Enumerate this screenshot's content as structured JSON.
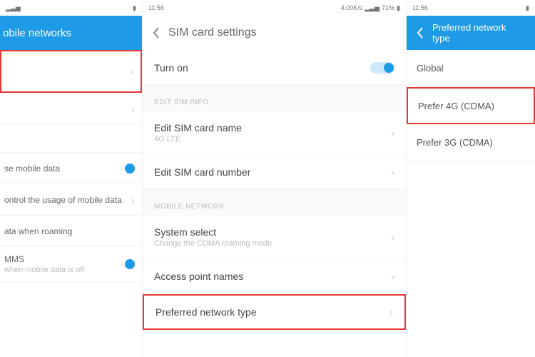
{
  "statusbar": {
    "time": "11:56",
    "carrier": "4.00K/s",
    "batt": "71%"
  },
  "screen1": {
    "header_title": "obile networks",
    "rows": {
      "r4_title": "se mobile data",
      "r5_title": "ontrol the usage of mobile data",
      "r6_title": "ata when roaming",
      "mms_title": "MMS",
      "mms_sub": "when mobile data is off"
    }
  },
  "screen2": {
    "header_title": "SIM card settings",
    "turn_on": "Turn on",
    "sec1": "Edit SIM info",
    "edit_name_title": "Edit SIM card name",
    "edit_name_sub": "4G LTE",
    "edit_num_title": "Edit SIM card number",
    "sec2": "Mobile network",
    "sys_sel_title": "System select",
    "sys_sel_sub": "Change the CDMA roaming mode",
    "apn_title": "Access point names",
    "pref_net_title": "Preferred network type"
  },
  "screen3": {
    "header_title": "Preferred network type",
    "opt1": "Global",
    "opt2": "Prefer 4G (CDMA)",
    "opt3": "Prefer 3G (CDMA)"
  }
}
